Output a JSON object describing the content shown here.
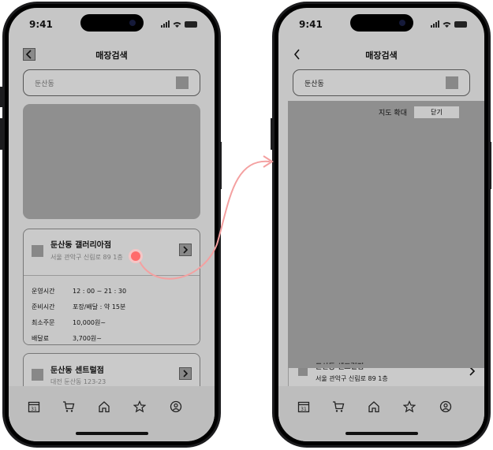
{
  "status": {
    "time": "9:41"
  },
  "left": {
    "title": "매장검색",
    "search_value": "둔산동",
    "stores": [
      {
        "name": "둔산동 갤러리아점",
        "address": "서울 관악구 신림로 89 1층",
        "hours_label": "운영시간",
        "hours_value": "12 : 00 ~ 21 : 30",
        "prep_label": "준비시간",
        "prep_value": "포장/배달 : 약 15분",
        "min_label": "최소주문",
        "min_value": "10,000원~",
        "fee_label": "배달료",
        "fee_value": "3,700원~"
      },
      {
        "name": "둔산동 센트럴점",
        "address": "대전 둔산동 123-23"
      }
    ]
  },
  "right": {
    "title": "매장검색",
    "search_value": "둔산동",
    "map_zoom_label": "지도 확대",
    "close_label": "닫기",
    "partial_store_name": "둔산동 센트럴점",
    "partial_address": "서울 관악구 신림로 89 1층"
  },
  "tabs": [
    "calendar-icon",
    "cart-icon",
    "home-icon",
    "star-icon",
    "profile-icon"
  ],
  "calendar_day": "31",
  "colors": {
    "tap_marker": "#ff6b6b",
    "arrow": "#f4a0a0"
  }
}
